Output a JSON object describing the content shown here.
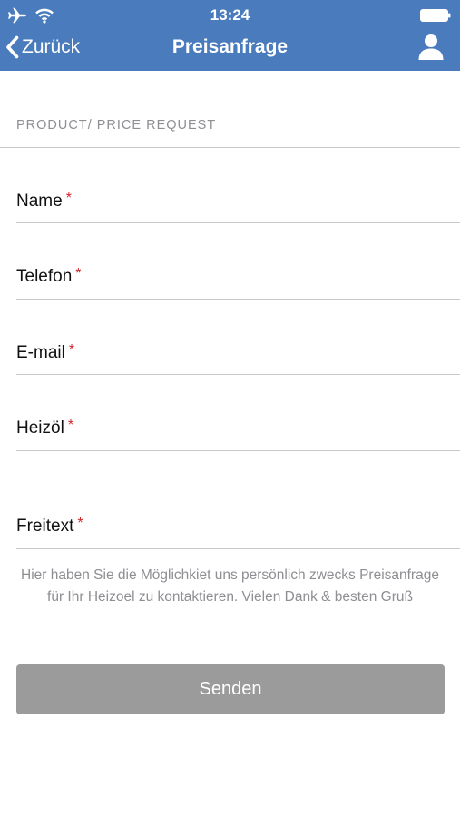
{
  "status_bar": {
    "time": "13:24",
    "airplane_icon": "airplane-icon",
    "wifi_icon": "wifi-icon",
    "battery_icon": "battery-icon"
  },
  "nav": {
    "back_label": "Zurück",
    "back_icon": "chevron-left-icon",
    "title": "Preisanfrage",
    "user_icon": "user-icon"
  },
  "form": {
    "section_header": "PRODUCT/ PRICE REQUEST",
    "required_marker": "*",
    "fields": [
      {
        "label": "Name",
        "value": ""
      },
      {
        "label": "Telefon",
        "value": ""
      },
      {
        "label": "E-mail",
        "value": ""
      },
      {
        "label": "Heizöl",
        "value": ""
      },
      {
        "label": "Freitext",
        "value": ""
      }
    ],
    "help_text": "Hier haben Sie die Möglichkiet uns persönlich zwecks Preisanfrage für Ihr Heizoel zu kontaktieren. Vielen Dank & besten Gruß",
    "submit_label": "Senden"
  },
  "colors": {
    "nav_background": "#4a7cbd",
    "required_marker": "#d2232a",
    "submit_background": "#9b9b9b",
    "separator": "#c8c7cc",
    "secondary_text": "#8e8e93"
  }
}
